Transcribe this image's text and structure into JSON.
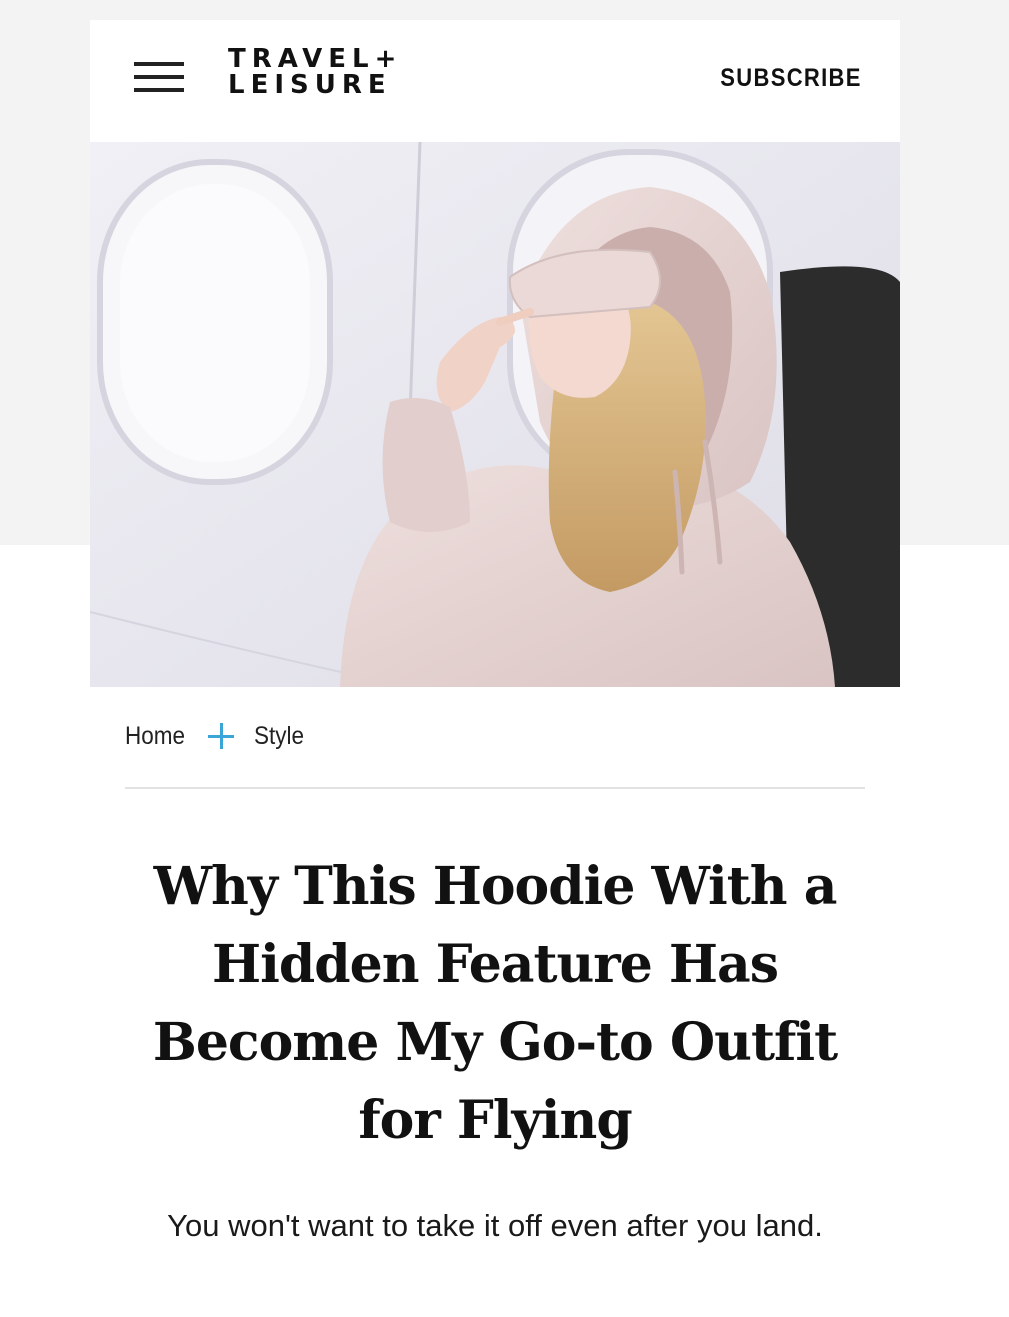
{
  "header": {
    "menu_icon": "hamburger-menu-icon",
    "logo_line1": "TRAVEL+",
    "logo_line2": "LEISURE",
    "subscribe_label": "SUBSCRIBE"
  },
  "breadcrumb": {
    "items": [
      "Home",
      "Style"
    ],
    "separator_icon": "plus-icon",
    "separator_color": "#3aa6d8"
  },
  "article": {
    "headline": "Why This Hoodie With a Hidden Feature Has Become My Go-to Outfit for Flying",
    "dek": "You won't want to take it off even after you land."
  },
  "colors": {
    "hoodie": "#e6d4d3",
    "hair": "#d7b684",
    "cabin_wall": "#e9e8ef",
    "seat": "#2c2c2c"
  }
}
